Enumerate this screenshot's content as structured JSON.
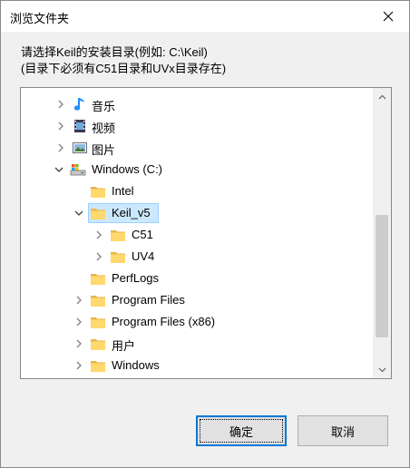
{
  "window": {
    "title": "浏览文件夹"
  },
  "description": {
    "line1": "请选择Keil的安装目录(例如: C:\\Keil)",
    "line2": "(目录下必须有C51目录和UVx目录存在)"
  },
  "tree": {
    "items": [
      {
        "label": "音乐",
        "icon": "music-note-icon",
        "expanded": false
      },
      {
        "label": "视频",
        "icon": "video-icon",
        "expanded": false
      },
      {
        "label": "图片",
        "icon": "picture-icon",
        "expanded": false
      },
      {
        "label": "Windows (C:)",
        "icon": "drive-icon",
        "expanded": true
      },
      {
        "label": "Intel",
        "icon": "folder-icon"
      },
      {
        "label": "Keil_v5",
        "icon": "folder-icon",
        "expanded": true,
        "selected": true
      },
      {
        "label": "C51",
        "icon": "folder-icon",
        "expanded": false
      },
      {
        "label": "UV4",
        "icon": "folder-icon",
        "expanded": false
      },
      {
        "label": "PerfLogs",
        "icon": "folder-icon"
      },
      {
        "label": "Program Files",
        "icon": "folder-icon",
        "expanded": false
      },
      {
        "label": "Program Files (x86)",
        "icon": "folder-icon",
        "expanded": false
      },
      {
        "label": "用户",
        "icon": "folder-icon",
        "expanded": false
      },
      {
        "label": "Windows",
        "icon": "folder-icon",
        "expanded": false
      }
    ]
  },
  "buttons": {
    "ok": "确定",
    "cancel": "取消"
  },
  "colors": {
    "selection": "#cce8ff",
    "folder": "#ffd86e",
    "accent": "#0078d7"
  }
}
